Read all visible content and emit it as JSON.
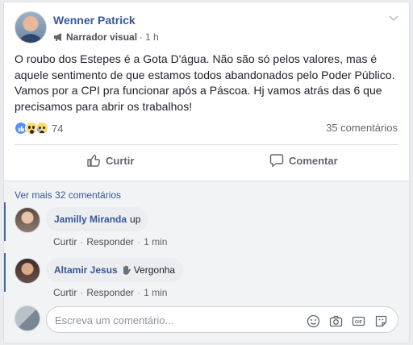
{
  "post": {
    "author": "Wenner Patrick",
    "role": "Narrador visual",
    "separator": "·",
    "time": "1 h",
    "text": "O roubo dos Estepes é a Gota D'água. Não são só pelos valores, mas é aquele sentimento de que estamos todos abandonados pelo Poder Público. Vamos por a CPI pra funcionar após a Páscoa. Hj vamos atrás das 6 que precisamos para abrir os trabalhos!",
    "reaction_count": "74",
    "comments_count": "35 comentários"
  },
  "actions": {
    "like": "Curtir",
    "comment": "Comentar"
  },
  "comments_section": {
    "view_more": "Ver mais 32 comentários",
    "items": [
      {
        "name": "Jamilly Miranda",
        "text": "up",
        "like": "Curtir",
        "reply": "Responder",
        "time": "1 min"
      },
      {
        "name": "Altamir Jesus",
        "text": "Vergonha",
        "like": "Curtir",
        "reply": "Responder",
        "time": "1 min"
      }
    ],
    "composer_placeholder": "Escreva um comentário..."
  },
  "colors": {
    "link": "#385898",
    "accent": "#4267b2",
    "like_blue": "#5890ff"
  },
  "icons": [
    "megaphone-icon",
    "chevron-down-icon",
    "like-reaction-icon",
    "wow-reaction-icon",
    "sad-reaction-icon",
    "thumbs-up-icon",
    "comment-icon",
    "wave-hand-icon",
    "emoji-icon",
    "camera-icon",
    "gif-icon",
    "sticker-icon"
  ]
}
